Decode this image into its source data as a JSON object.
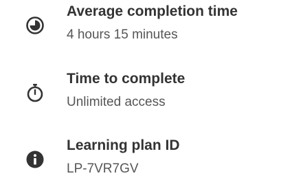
{
  "colors": {
    "title_text": "#333333",
    "value_text": "#555555",
    "icon": "#333333"
  },
  "items": [
    {
      "icon": "clock-pie-icon",
      "title": "Average completion time",
      "value": "4 hours 15 minutes"
    },
    {
      "icon": "stopwatch-icon",
      "title": "Time to complete",
      "value": "Unlimited access"
    },
    {
      "icon": "info-icon",
      "title": "Learning plan ID",
      "value": "LP-7VR7GV"
    }
  ]
}
